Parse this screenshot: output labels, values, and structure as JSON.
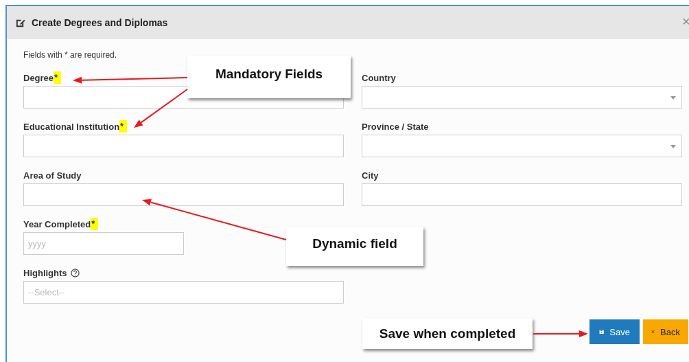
{
  "dialog": {
    "title": "Create Degrees and Diplomas",
    "close": "×",
    "note": "Fields with * are required.",
    "left_fields": [
      {
        "label": "Degree",
        "required_mark": "*",
        "kind": "text"
      },
      {
        "label": "Educational Institution",
        "required_mark": "*",
        "kind": "text"
      },
      {
        "label": "Area of Study",
        "kind": "text"
      },
      {
        "label": "Year Completed",
        "required_mark": "*",
        "kind": "short",
        "placeholder": "yyyy"
      },
      {
        "label": "Highlights",
        "kind": "select",
        "help": true,
        "placeholder": "--Select--"
      }
    ],
    "right_fields": [
      {
        "label": "Country",
        "kind": "dropdown"
      },
      {
        "label": "Province / State",
        "kind": "dropdown"
      },
      {
        "label": "City",
        "kind": "text"
      }
    ],
    "buttons": [
      {
        "label": "Save",
        "kind": "primary"
      },
      {
        "label": "Back",
        "kind": "warning"
      }
    ]
  },
  "annotations": [
    {
      "text": "Mandatory Fields",
      "kind": "mandatory"
    },
    {
      "text": "Dynamic field",
      "kind": "dynamic"
    },
    {
      "text": "Save when completed",
      "kind": "save"
    }
  ]
}
